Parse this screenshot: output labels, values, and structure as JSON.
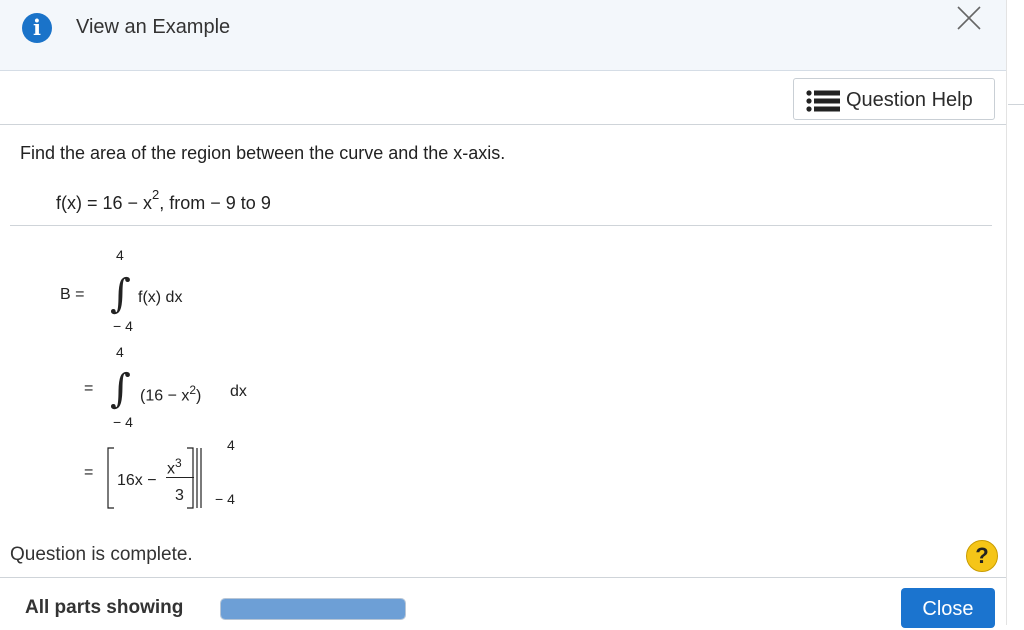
{
  "header": {
    "info_label": "i",
    "view_example": "View an Example"
  },
  "question_help": {
    "label": "Question Help"
  },
  "question": {
    "prompt": "Find the area of the region between the curve and the x-axis.",
    "function_lhs": "f(x) = 16 − x",
    "function_exp": "2",
    "function_rest": ", from  − 9 to 9"
  },
  "work": {
    "b_label": "B =",
    "upper1": "4",
    "lower1": "− 4",
    "integrand1": "f(x) dx",
    "eq2": "=",
    "upper2": "4",
    "lower2": "− 4",
    "integrand2_a": "(16 − x",
    "integrand2_exp": "2",
    "integrand2_b": ")",
    "dx2": "dx",
    "eq3": "=",
    "term": "16x −",
    "frac_num": "x",
    "frac_num_exp": "3",
    "frac_den": "3",
    "eval_upper": "4",
    "eval_lower": "− 4"
  },
  "status": {
    "complete": "Question is complete.",
    "help_symbol": "?"
  },
  "footer": {
    "parts": "All parts showing",
    "progress_fraction": 1.0,
    "close": "Close"
  },
  "colors": {
    "accent": "#1b74cf",
    "help": "#f5c518",
    "progress": "#6d9fd6"
  },
  "icons": [
    "info-icon",
    "close-icon",
    "list-icon",
    "help-icon"
  ]
}
